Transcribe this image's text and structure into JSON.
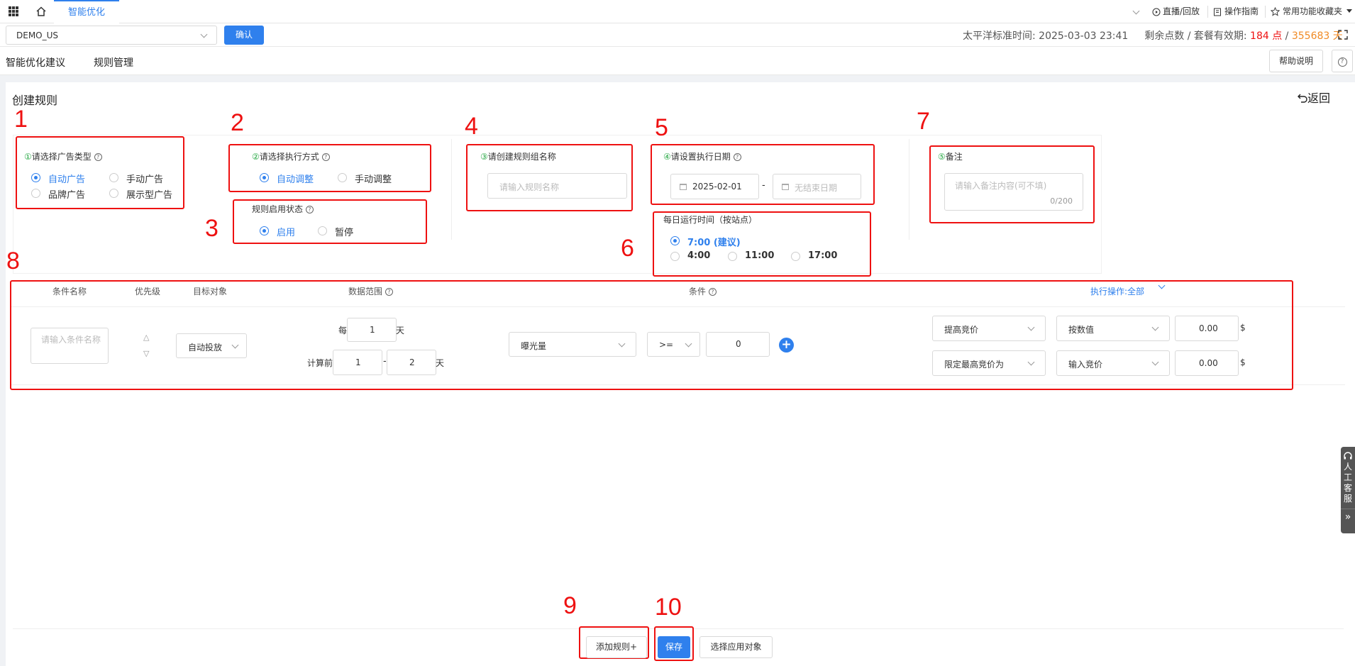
{
  "topbar": {
    "tab": "智能优化",
    "live": "直播/回放",
    "guide": "操作指南",
    "favorites": "常用功能收藏夹"
  },
  "toolbar": {
    "account": "DEMO_US",
    "confirm": "确认",
    "time_label": "太平洋标准时间:",
    "time_value": "2025-03-03 23:41",
    "points_label": "剩余点数 / 套餐有效期:",
    "points_value": "184 点",
    "slash": "/",
    "days_value": "355683 天"
  },
  "nav": {
    "tab1": "智能优化建议",
    "tab2": "规则管理",
    "help": "帮助说明",
    "help_icon": "?"
  },
  "page": {
    "title": "创建规则",
    "back": "返回"
  },
  "annotations": [
    "1",
    "2",
    "3",
    "4",
    "5",
    "6",
    "7",
    "8",
    "9",
    "10"
  ],
  "sections": {
    "ad_type": {
      "num": "①",
      "label": "请选择广告类型",
      "options": [
        "自动广告",
        "手动广告",
        "品牌广告",
        "展示型广告"
      ],
      "selected": "自动广告"
    },
    "exec_mode": {
      "num": "②",
      "label": "请选择执行方式",
      "options": [
        "自动调整",
        "手动调整"
      ],
      "selected": "自动调整"
    },
    "status": {
      "label": "规则启用状态",
      "options": [
        "启用",
        "暂停"
      ],
      "selected": "启用"
    },
    "group_name": {
      "num": "③",
      "label": "请创建规则组名称",
      "placeholder": "请输入规则名称"
    },
    "exec_date": {
      "num": "④",
      "label": "请设置执行日期",
      "start": "2025-02-01",
      "dash": "-",
      "end_placeholder": "无结束日期"
    },
    "run_time": {
      "label": "每日运行时间（按站点）",
      "options": [
        "7:00 (建议)",
        "4:00",
        "11:00",
        "17:00"
      ],
      "selected": "7:00 (建议)"
    },
    "note": {
      "num": "⑤",
      "label": "备注",
      "placeholder": "请输入备注内容(可不填)",
      "counter": "0/200"
    }
  },
  "table": {
    "headers": {
      "name": "条件名称",
      "priority": "优先级",
      "target": "目标对象",
      "range": "数据范围",
      "condition": "条件",
      "action": "执行操作:",
      "action_all": "全部"
    },
    "row": {
      "name_placeholder": "请输入条件名称",
      "up": "△",
      "down": "▽",
      "target": "自动投放",
      "every": "每",
      "every_value": "1",
      "day": "天",
      "calc": "计算前",
      "calc_from": "1",
      "calc_dash": "-",
      "calc_to": "2",
      "metric": "曝光量",
      "operator": ">=",
      "threshold": "0",
      "plus": "+",
      "action1": "提高竞价",
      "mode1": "按数值",
      "value1": "0.00",
      "unit1": "$",
      "action2": "限定最高竞价为",
      "mode2": "输入竞价",
      "value2": "0.00",
      "unit2": "$"
    }
  },
  "footer": {
    "add": "添加规则+",
    "save": "保存",
    "apply": "选择应用对象"
  },
  "service": {
    "label": "人工客服",
    "chars": [
      "人",
      "工",
      "客",
      "服"
    ],
    "collapse": "»"
  }
}
